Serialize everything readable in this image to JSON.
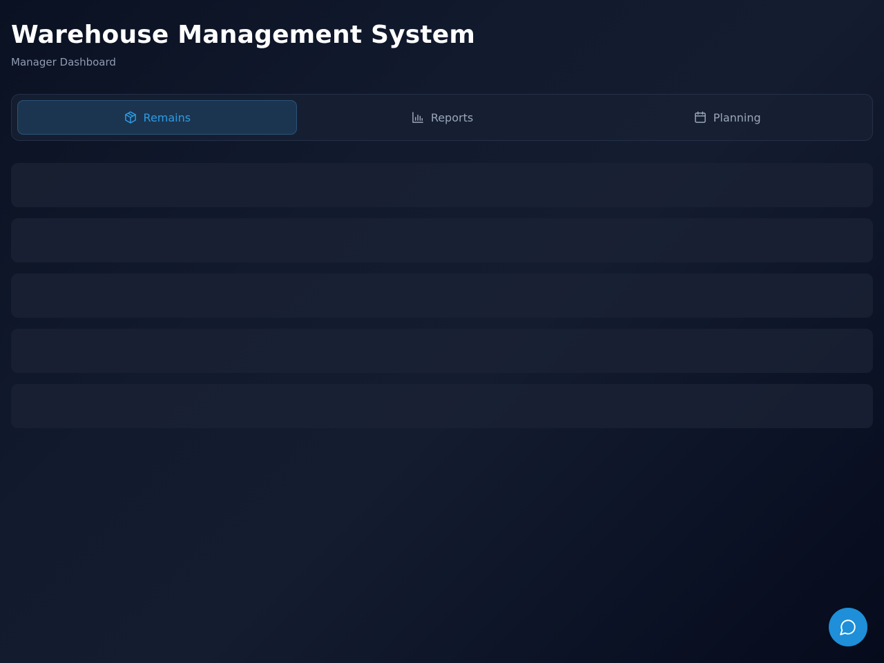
{
  "header": {
    "title": "Warehouse Management System",
    "subtitle": "Manager Dashboard"
  },
  "tabs": [
    {
      "label": "Remains",
      "icon": "box-icon",
      "active": true
    },
    {
      "label": "Reports",
      "icon": "bar-chart-icon",
      "active": false
    },
    {
      "label": "Planning",
      "icon": "calendar-icon",
      "active": false
    }
  ],
  "content": {
    "state": "loading",
    "placeholder_rows": 5
  },
  "chat_button": {
    "icon": "chat-bubble-icon"
  },
  "colors": {
    "accent": "#2e9be4",
    "fab": "#1e8fd8",
    "background": "#0f1629",
    "muted_text": "#8f9cb3"
  }
}
